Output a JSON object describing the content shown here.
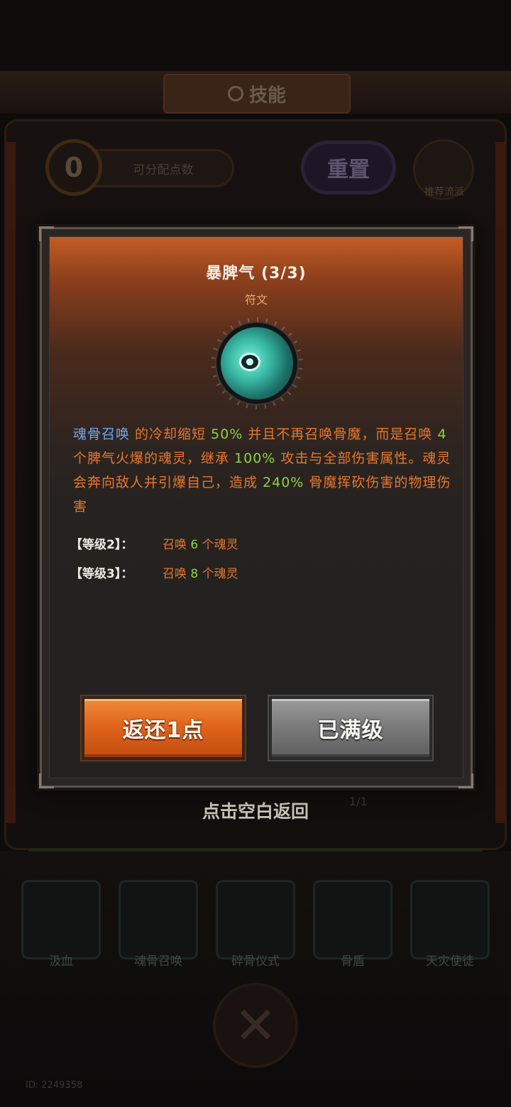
{
  "background": {
    "screen_title": "技能",
    "points_value": "0",
    "points_label": "可分配点数",
    "reset_label": "重置",
    "recommend_label": "推荐流派",
    "return_hint": "点击空白返回",
    "progress_fraction": "1/1",
    "skills": [
      "汲血",
      "魂骨召唤",
      "碎骨仪式",
      "骨盾",
      "天灾使徒"
    ],
    "player_id": "ID: 2249358"
  },
  "modal": {
    "title": "暴脾气 (3/3)",
    "subtitle": "符文",
    "icon": "soul-rune-icon",
    "description": {
      "skill_ref": "魂骨召唤",
      "p1": " 的冷却缩短 ",
      "v1": "50%",
      "p2": " 并且不再召唤骨魔，而是召唤 ",
      "v2": "4",
      "p3": " 个脾气火爆的魂灵，继承 ",
      "v3": "100%",
      "p4": " 攻击与全部伤害属性。魂灵会奔向敌人并引爆自己，造成 ",
      "v4": "240%",
      "p5": " 骨魔挥砍伤害的物理伤害"
    },
    "levels": [
      {
        "key": "【等级2】：",
        "pre": "召唤 ",
        "num": "6",
        "post": " 个魂灵"
      },
      {
        "key": "【等级3】：",
        "pre": "召唤 ",
        "num": "8",
        "post": " 个魂灵"
      }
    ],
    "refund_button": "返还1点",
    "maxed_button": "已满级"
  },
  "colors": {
    "description_orange": "#e8772e",
    "highlight_green": "#8cd640",
    "skill_blue": "#6fa8f0",
    "refund_button": "#e0661c",
    "maxed_button": "#7c7c7c"
  }
}
